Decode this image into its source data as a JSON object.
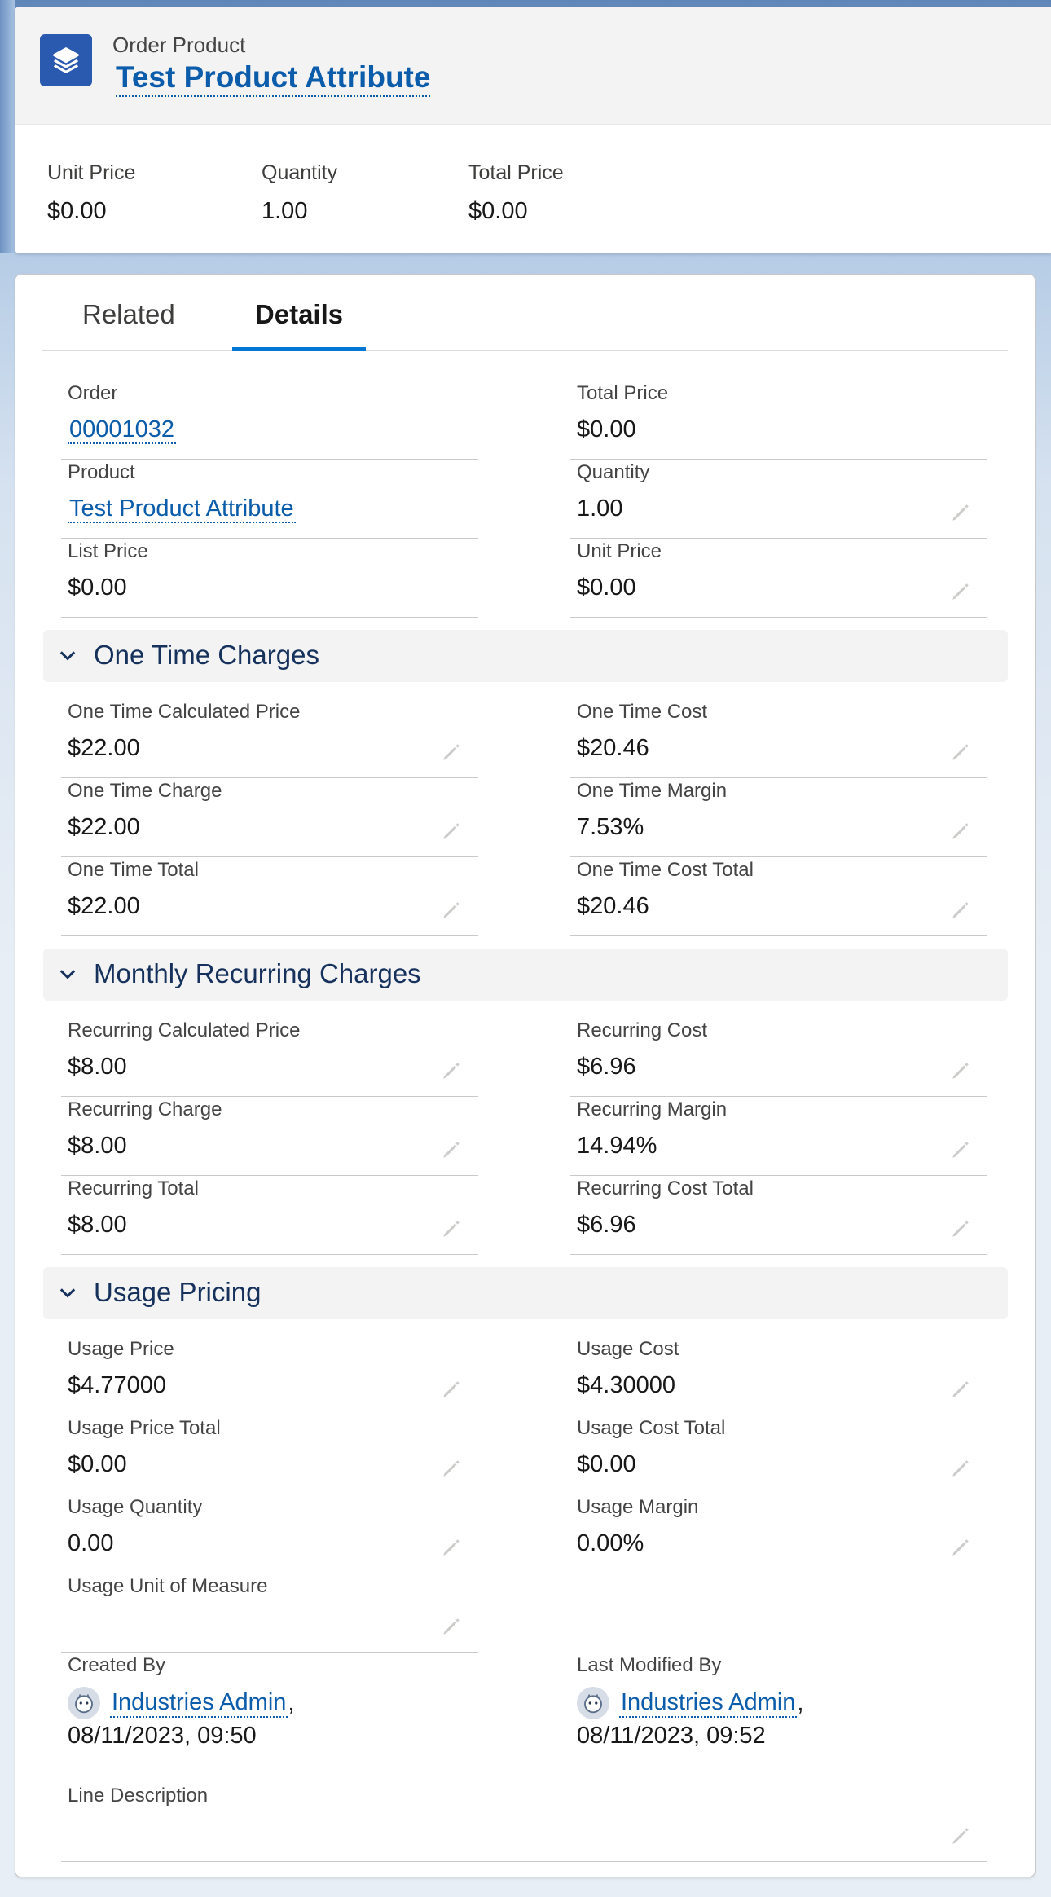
{
  "header": {
    "object_type": "Order Product",
    "record_title": "Test Product Attribute",
    "highlights": [
      {
        "label": "Unit Price",
        "value": "$0.00"
      },
      {
        "label": "Quantity",
        "value": "1.00"
      },
      {
        "label": "Total Price",
        "value": "$0.00"
      }
    ]
  },
  "tabs": [
    {
      "label": "Related",
      "active": false
    },
    {
      "label": "Details",
      "active": true
    }
  ],
  "details": {
    "order": {
      "label": "Order",
      "value": "00001032"
    },
    "total_price": {
      "label": "Total Price",
      "value": "$0.00"
    },
    "product": {
      "label": "Product",
      "value": "Test Product Attribute"
    },
    "quantity": {
      "label": "Quantity",
      "value": "1.00"
    },
    "list_price": {
      "label": "List Price",
      "value": "$0.00"
    },
    "unit_price": {
      "label": "Unit Price",
      "value": "$0.00"
    }
  },
  "one_time": {
    "title": "One Time Charges",
    "fields": [
      {
        "label": "One Time Calculated Price",
        "value": "$22.00"
      },
      {
        "label": "One Time Cost",
        "value": "$20.46"
      },
      {
        "label": "One Time Charge",
        "value": "$22.00"
      },
      {
        "label": "One Time Margin",
        "value": "7.53%"
      },
      {
        "label": "One Time Total",
        "value": "$22.00"
      },
      {
        "label": "One Time Cost Total",
        "value": "$20.46"
      }
    ]
  },
  "recurring": {
    "title": "Monthly Recurring Charges",
    "fields": [
      {
        "label": "Recurring Calculated Price",
        "value": "$8.00"
      },
      {
        "label": "Recurring Cost",
        "value": "$6.96"
      },
      {
        "label": "Recurring Charge",
        "value": "$8.00"
      },
      {
        "label": "Recurring Margin",
        "value": "14.94%"
      },
      {
        "label": "Recurring Total",
        "value": "$8.00"
      },
      {
        "label": "Recurring Cost Total",
        "value": "$6.96"
      }
    ]
  },
  "usage": {
    "title": "Usage Pricing",
    "fields": [
      {
        "label": "Usage Price",
        "value": "$4.77000"
      },
      {
        "label": "Usage Cost",
        "value": "$4.30000"
      },
      {
        "label": "Usage Price Total",
        "value": "$0.00"
      },
      {
        "label": "Usage Cost Total",
        "value": "$0.00"
      },
      {
        "label": "Usage Quantity",
        "value": "0.00"
      },
      {
        "label": "Usage Margin",
        "value": "0.00%"
      },
      {
        "label": "Usage Unit of Measure",
        "value": ""
      }
    ]
  },
  "system": {
    "created_by": {
      "label": "Created By",
      "user": "Industries Admin",
      "date": "08/11/2023, 09:50"
    },
    "modified_by": {
      "label": "Last Modified By",
      "user": "Industries Admin",
      "date": "08/11/2023, 09:52"
    },
    "line_description": {
      "label": "Line Description",
      "value": ""
    }
  },
  "colors": {
    "link": "#0b5cab",
    "brand": "#2a59b0",
    "tab_active": "#0176d3",
    "section_bg": "#f3f3f3"
  },
  "icons": {
    "object": "layers-icon",
    "section": "chevron-down-icon",
    "edit": "pencil-icon",
    "user": "user-avatar-icon"
  }
}
